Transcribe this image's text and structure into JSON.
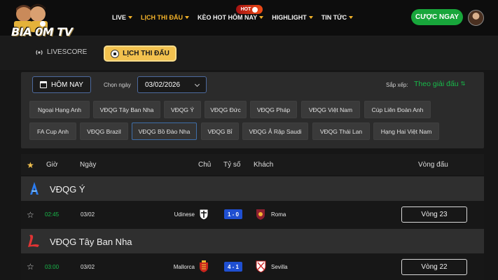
{
  "header": {
    "logo_text": "BIA 0M TV",
    "hot_badge": "HOT",
    "nav": [
      {
        "label": "LIVE",
        "active": false
      },
      {
        "label": "LỊCH THI ĐẤU",
        "active": true
      },
      {
        "label": "KÈO HOT HÔM NAY",
        "active": false
      },
      {
        "label": "HIGHLIGHT",
        "active": false
      },
      {
        "label": "TIN TỨC",
        "active": false
      }
    ],
    "bet_button": "CƯỢC NGAY"
  },
  "subnav": {
    "livescore": "LIVESCORE",
    "schedule": "LỊCH THI ĐẤU"
  },
  "filters": {
    "today": "HÔM NAY",
    "date_label": "Chọn ngày",
    "date_value": "03/02/2026",
    "sort_label": "Sắp xếp:",
    "sort_value": "Theo giải đấu",
    "leagues": [
      "Ngoại Hạng Anh",
      "VĐQG Tây Ban Nha",
      "VĐQG Ý",
      "VĐQG Đức",
      "VĐQG Pháp",
      "VĐQG Việt Nam",
      "Cúp Liên Đoàn Anh",
      "FA Cup Anh",
      "VĐQG Brazil",
      "VĐQG Bồ Đào Nha",
      "VĐQG Bỉ",
      "VĐQG Ả Rập Saudi",
      "VĐQG Thái Lan",
      "Hạng Hai Việt Nam"
    ],
    "active_league": "VĐQG Bồ Đào Nha"
  },
  "table": {
    "headers": {
      "time": "Giờ",
      "date": "Ngày",
      "home": "Chủ",
      "score": "Tỷ số",
      "away": "Khách",
      "round": "Vòng đấu"
    },
    "groups": [
      {
        "league": "VĐQG Ý",
        "matches": [
          {
            "time": "02:45",
            "date": "03/02",
            "home": "Udinese",
            "score": "1 - 0",
            "away": "Roma",
            "round": "Vòng 23"
          }
        ]
      },
      {
        "league": "VĐQG Tây Ban Nha",
        "matches": [
          {
            "time": "03:00",
            "date": "03/02",
            "home": "Mallorca",
            "score": "4 - 1",
            "away": "Sevilla",
            "round": "Vòng 22"
          }
        ]
      }
    ]
  },
  "colors": {
    "accent": "#f5b42a",
    "green": "#18b94a",
    "score_blue": "#1f4fd1"
  }
}
